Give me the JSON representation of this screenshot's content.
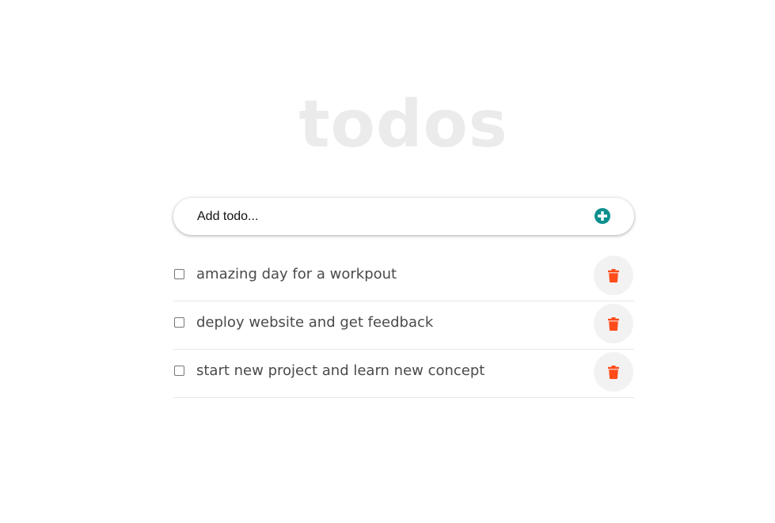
{
  "app": {
    "title": "todos"
  },
  "add_bar": {
    "placeholder": "Add todo...",
    "button_icon": "plus-circle-icon",
    "accent_color": "#0e8f8f"
  },
  "todos": [
    {
      "text": "amazing day for a workpout",
      "completed": false
    },
    {
      "text": "deploy website and get feedback",
      "completed": false
    },
    {
      "text": "start new project and learn new concept",
      "completed": false
    }
  ],
  "delete_button": {
    "icon": "trash-icon",
    "icon_color": "#ff4c1a"
  }
}
